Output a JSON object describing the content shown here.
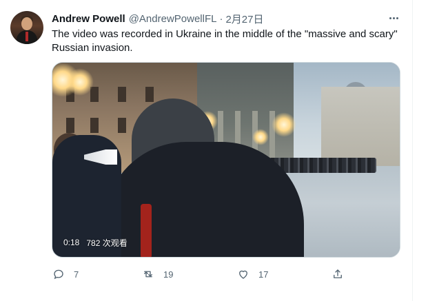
{
  "tweet": {
    "display_name": "Andrew Powell",
    "handle": "@AndrewPowellFL",
    "separator": "·",
    "date": "2月27日",
    "text": "The video was recorded in Ukraine in the middle of the \"massive and scary\" Russian invasion.",
    "avatar_icon": "user-avatar-photo",
    "more_icon": "more-options-icon"
  },
  "media": {
    "type": "video",
    "duration": "0:18",
    "views": "782 次观看"
  },
  "actions": {
    "reply": {
      "icon": "reply-icon",
      "count": "7"
    },
    "retweet": {
      "icon": "retweet-icon",
      "count": "19"
    },
    "like": {
      "icon": "heart-icon",
      "count": "17"
    },
    "share": {
      "icon": "share-icon"
    }
  },
  "colors": {
    "text_primary": "#0f1419",
    "text_secondary": "#536471",
    "border": "#cfd9de"
  }
}
